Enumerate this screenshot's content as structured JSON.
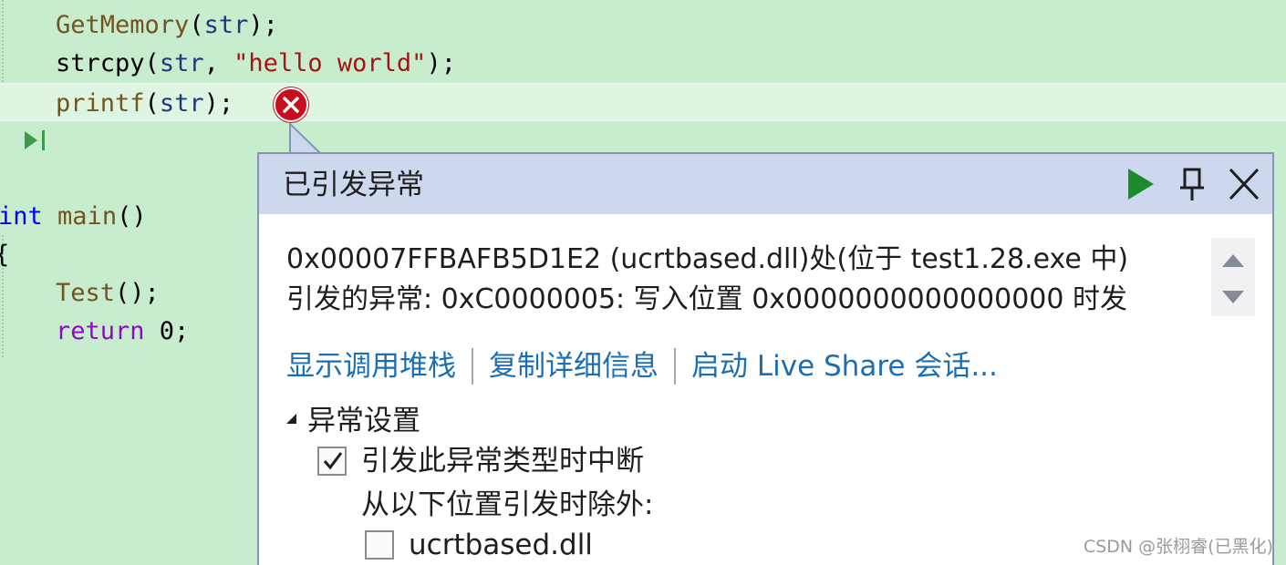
{
  "editor": {
    "lines": [
      {
        "id": "line-getmemory",
        "tokens": [
          {
            "text": "GetMemory",
            "kind": "fn"
          },
          {
            "text": "(",
            "kind": "plain"
          },
          {
            "text": "str",
            "kind": "var"
          },
          {
            "text": ");",
            "kind": "plain"
          }
        ]
      },
      {
        "id": "line-strcpy",
        "tokens": [
          {
            "text": "strcpy",
            "kind": "plain"
          },
          {
            "text": "(",
            "kind": "plain"
          },
          {
            "text": "str",
            "kind": "var"
          },
          {
            "text": ", ",
            "kind": "plain"
          },
          {
            "text": "\"hello world\"",
            "kind": "str"
          },
          {
            "text": ");",
            "kind": "plain"
          }
        ]
      },
      {
        "id": "line-printf",
        "tokens": [
          {
            "text": "printf",
            "kind": "fn"
          },
          {
            "text": "(",
            "kind": "plain"
          },
          {
            "text": "str",
            "kind": "var"
          },
          {
            "text": ");",
            "kind": "plain"
          }
        ]
      },
      {
        "id": "line-close-test",
        "tokens": [
          {
            "text": "}",
            "kind": "plain"
          }
        ]
      },
      {
        "id": "line-blank",
        "tokens": []
      },
      {
        "id": "line-main",
        "tokens": [
          {
            "text": "int",
            "kind": "kw"
          },
          {
            "text": " ",
            "kind": "plain"
          },
          {
            "text": "main",
            "kind": "fn"
          },
          {
            "text": "()",
            "kind": "plain"
          }
        ]
      },
      {
        "id": "line-open-brace",
        "tokens": [
          {
            "text": "{",
            "kind": "plain"
          }
        ]
      },
      {
        "id": "line-test-call",
        "tokens": [
          {
            "text": "Test",
            "kind": "fn"
          },
          {
            "text": "();",
            "kind": "plain"
          }
        ]
      },
      {
        "id": "line-return",
        "tokens": [
          {
            "text": "return",
            "kind": "ctl"
          },
          {
            "text": " 0;",
            "kind": "plain"
          }
        ]
      },
      {
        "id": "line-close-main",
        "tokens": [
          {
            "text": "}",
            "kind": "plain"
          }
        ]
      }
    ],
    "current_line_id": "line-printf"
  },
  "exception": {
    "title": "已引发异常",
    "message_line1": "0x00007FFBAFB5D1E2 (ucrtbased.dll)处(位于 test1.28.exe 中)",
    "message_line2": "引发的异常: 0xC0000005: 写入位置 0x0000000000000000 时发",
    "links": {
      "show_call_stack": "显示调用堆栈",
      "copy_details": "复制详细信息",
      "start_live_share": "启动 Live Share 会话..."
    },
    "settings": {
      "header": "异常设置",
      "break_when_thrown": {
        "label": "引发此异常类型时中断",
        "checked": true
      },
      "except_when_from": "从以下位置引发时除外:",
      "module_option": {
        "label": "ucrtbased.dll",
        "checked": false
      }
    },
    "icons": {
      "continue": "play-icon",
      "pin": "pin-icon",
      "close": "close-icon",
      "error": "error-icon"
    }
  },
  "watermark": "CSDN @张栩睿(已黑化)",
  "colors": {
    "editor_background": "#c7ecce",
    "current_line": "#def5e2",
    "popup_header": "#cdd7ee",
    "link": "#1a6fb4",
    "error": "#c50f1f",
    "continue_green": "#1e8a2e"
  }
}
